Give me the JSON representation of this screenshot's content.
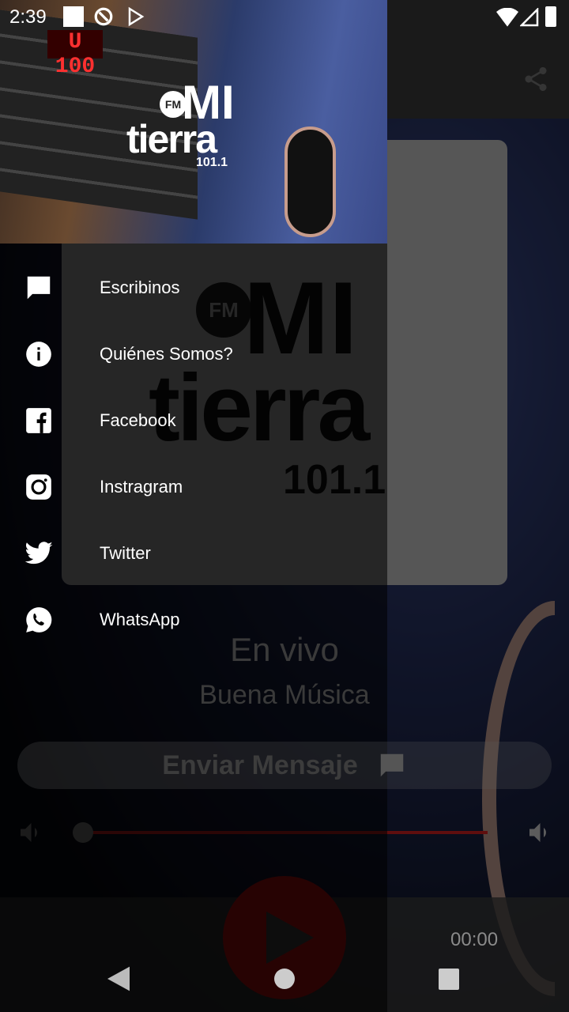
{
  "status_bar": {
    "time": "2:39"
  },
  "header": {
    "logo_text": "FM MI tierra 101.1",
    "display": "U 100"
  },
  "drawer": {
    "items": [
      {
        "label": "Escribinos",
        "icon": "chat-icon"
      },
      {
        "label": "Quiénes Somos?",
        "icon": "info-icon"
      },
      {
        "label": "Facebook",
        "icon": "facebook-icon"
      },
      {
        "label": "Instragram",
        "icon": "instagram-icon"
      },
      {
        "label": "Twitter",
        "icon": "twitter-icon"
      },
      {
        "label": "WhatsApp",
        "icon": "whatsapp-icon"
      }
    ]
  },
  "main": {
    "live_label": "En vivo",
    "subtitle": "Buena Música",
    "send_message_label": "Enviar Mensaje",
    "volume_fraction": 0,
    "elapsed": "00:00",
    "accent": "#d21f1f"
  }
}
